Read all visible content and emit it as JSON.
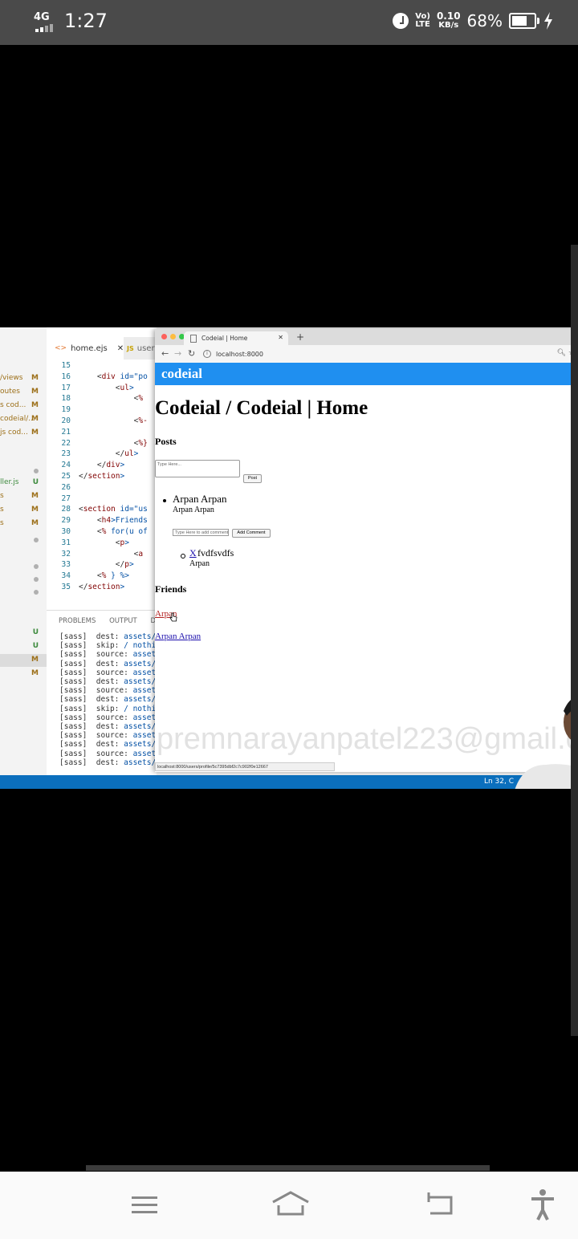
{
  "status_bar": {
    "network": "4G",
    "time": "1:27",
    "volte": [
      "Vo)",
      "LTE"
    ],
    "speed_value": "0.10",
    "speed_unit": "KB/s",
    "battery_percent": "68%",
    "battery_level": 0.68
  },
  "vscode": {
    "tabs": [
      {
        "label": "home.ejs",
        "icon": "code-icon"
      },
      {
        "label": "user",
        "icon": "js-icon"
      }
    ],
    "explorer": [
      {
        "name": "/views",
        "status": "M"
      },
      {
        "name": "outes",
        "status": "M"
      },
      {
        "name": "s cod...",
        "status": "M"
      },
      {
        "name": "codeial/...",
        "status": "M"
      },
      {
        "name": "js cod...",
        "status": "M"
      },
      {
        "name": "ller.js",
        "status": "U"
      },
      {
        "name": "s",
        "status": "M"
      },
      {
        "name": "s",
        "status": "M"
      },
      {
        "name": "s",
        "status": "M"
      },
      {
        "name": "",
        "status": "U"
      },
      {
        "name": "",
        "status": "U"
      },
      {
        "name": "",
        "status": "M"
      },
      {
        "name": "",
        "status": "M"
      }
    ],
    "line_numbers": [
      "15",
      "16",
      "17",
      "18",
      "19",
      "20",
      "21",
      "22",
      "23",
      "24",
      "25",
      "26",
      "27",
      "28",
      "29",
      "30",
      "31",
      "32",
      "33",
      "34",
      "35"
    ],
    "code_lines": [
      {
        "open": "",
        "tag": "",
        "rest": ""
      },
      {
        "open": "    <",
        "tag": "div",
        "rest": " id=\"po"
      },
      {
        "open": "        <",
        "tag": "ul",
        "rest": ">"
      },
      {
        "open": "            <",
        "tag": "%",
        "rest": ""
      },
      {
        "open": "",
        "tag": "",
        "rest": ""
      },
      {
        "open": "            <",
        "tag": "%-",
        "rest": ""
      },
      {
        "open": "",
        "tag": "",
        "rest": ""
      },
      {
        "open": "            <",
        "tag": "%}",
        "rest": ""
      },
      {
        "open": "        </",
        "tag": "ul",
        "rest": ">"
      },
      {
        "open": "    </",
        "tag": "div",
        "rest": ">"
      },
      {
        "open": "</",
        "tag": "section",
        "rest": ">"
      },
      {
        "open": "",
        "tag": "",
        "rest": ""
      },
      {
        "open": "",
        "tag": "",
        "rest": ""
      },
      {
        "open": "<",
        "tag": "section",
        "rest": " id=\"us"
      },
      {
        "open": "    <",
        "tag": "h4",
        "rest": ">Friends"
      },
      {
        "open": "    <",
        "tag": "%",
        "rest": " for(u of"
      },
      {
        "open": "        <",
        "tag": "p",
        "rest": ">"
      },
      {
        "open": "            <",
        "tag": "a",
        "rest": ""
      },
      {
        "open": "        </",
        "tag": "p",
        "rest": ">"
      },
      {
        "open": "    <",
        "tag": "%",
        "rest": " } %>"
      },
      {
        "open": "</",
        "tag": "section",
        "rest": ">"
      }
    ],
    "panel_tabs": [
      "PROBLEMS",
      "OUTPUT",
      "DE"
    ],
    "terminal_lines": [
      {
        "label": "[sass]",
        "key": "dest:",
        "path": "assets/c"
      },
      {
        "label": "[sass]",
        "key": "skip:",
        "path": "/ nothing"
      },
      {
        "label": "[sass]",
        "key": "source:",
        "path": "assets,"
      },
      {
        "label": "[sass]",
        "key": "dest:",
        "path": "assets/c"
      },
      {
        "label": "[sass]",
        "key": "source:",
        "path": "assets,"
      },
      {
        "label": "[sass]",
        "key": "dest:",
        "path": "assets/c"
      },
      {
        "label": "[sass]",
        "key": "source:",
        "path": "assets,"
      },
      {
        "label": "[sass]",
        "key": "dest:",
        "path": "assets/c"
      },
      {
        "label": "[sass]",
        "key": "skip:",
        "path": "/ nothin"
      },
      {
        "label": "[sass]",
        "key": "source:",
        "path": "assets,"
      },
      {
        "label": "[sass]",
        "key": "dest:",
        "path": "assets/c"
      },
      {
        "label": "[sass]",
        "key": "source:",
        "path": "assets,"
      },
      {
        "label": "[sass]",
        "key": "dest:",
        "path": "assets/c"
      },
      {
        "label": "[sass]",
        "key": "source:",
        "path": "assets,"
      },
      {
        "label": "[sass]",
        "key": "dest:",
        "path": "assets/c"
      }
    ],
    "statusbar_right": "Ln 32, C"
  },
  "browser": {
    "tab_title": "Codeial | Home",
    "url": "localhost:8000",
    "new_tab": "+",
    "status_url": "localhost:8000/users/profile/5c7395dbf2c7c902f0e12667"
  },
  "page": {
    "brand": "codeial",
    "heading": "Codeial / Codeial | Home",
    "posts_heading": "Posts",
    "post_placeholder": "Type Here...",
    "post_button": "Post",
    "post": {
      "content": "Arpan Arpan",
      "author": "Arpan Arpan",
      "comment_placeholder": "Type Here to add comment",
      "comment_button": "Add Comment",
      "comment": {
        "delete": "X",
        "content": "fvdfsvdfs",
        "author": "Arpan"
      }
    },
    "friends_heading": "Friends",
    "friends": [
      "Arpan",
      "Arpan Arpan"
    ],
    "watermark": "premnarayanpatel223@gmail.c"
  },
  "colors": {
    "site_header": "#1f8ff0",
    "vscode_status": "#0b6fbd",
    "status_bar": "#4a4a4a"
  },
  "nav_bar": {
    "icons": [
      "menu-icon",
      "home-icon",
      "back-icon",
      "accessibility-icon"
    ]
  }
}
